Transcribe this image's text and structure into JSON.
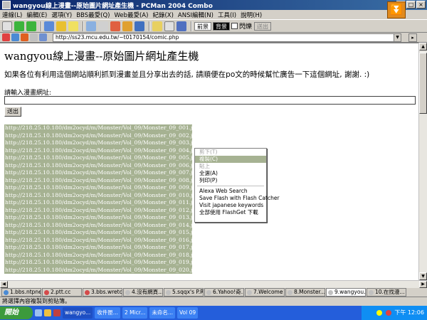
{
  "window": {
    "title": "wangyou線上漫畫--原始圖片網址產生機 - PCMan 2004 Combo"
  },
  "menu": [
    "連線(L)",
    "編輯(E)",
    "選項(Y)",
    "BBS最愛(Q)",
    "Web最愛(A)",
    "紀錄(X)",
    "ANSI編輯(N)",
    "工具(I)",
    "說明(H)"
  ],
  "toolbar": {
    "mode_front": "前景",
    "mode_back": "背景",
    "flash_label": "閃爍",
    "send_label": "送出"
  },
  "address": {
    "url": "http://ss23.mcu.edu.tw/~t0170154/comic.php"
  },
  "page": {
    "heading": "wangyou線上漫畫--原始圖片網址產生機",
    "description": "如果各位有利用這個網站順利抓到漫畫並且分享出去的話, 請順便在po文的時候幫忙廣告一下這個網址, 謝謝. :)",
    "input_label": "請輸入漫畫網址:",
    "send_button": "送出",
    "urls": [
      "http://218.25.10.180/dm2ocyd/m/Monster/Vol_09/Monster_09_001.jpg",
      "http://218.25.10.180/dm2ocyd/m/Monster/Vol_09/Monster_09_002.jpg",
      "http://218.25.10.180/dm2ocyd/m/Monster/Vol_09/Monster_09_003.jpg",
      "http://218.25.10.180/dm2ocyd/m/Monster/Vol_09/Monster_09_004.jpg",
      "http://218.25.10.180/dm2ocyd/m/Monster/Vol_09/Monster_09_005.jpg",
      "http://218.25.10.180/dm2ocyd/m/Monster/Vol_09/Monster_09_006.jpg",
      "http://218.25.10.180/dm2ocyd/m/Monster/Vol_09/Monster_09_007.jpg",
      "http://218.25.10.180/dm2ocyd/m/Monster/Vol_09/Monster_09_008.jpg",
      "http://218.25.10.180/dm2ocyd/m/Monster/Vol_09/Monster_09_009.jpg",
      "http://218.25.10.180/dm2ocyd/m/Monster/Vol_09/Monster_09_010.jpg",
      "http://218.25.10.180/dm2ocyd/m/Monster/Vol_09/Monster_09_011.jpg",
      "http://218.25.10.180/dm2ocyd/m/Monster/Vol_09/Monster_09_012.jpg",
      "http://218.25.10.180/dm2ocyd/m/Monster/Vol_09/Monster_09_013.jpg",
      "http://218.25.10.180/dm2ocyd/m/Monster/Vol_09/Monster_09_014.jpg",
      "http://218.25.10.180/dm2ocyd/m/Monster/Vol_09/Monster_09_015.jpg",
      "http://218.25.10.180/dm2ocyd/m/Monster/Vol_09/Monster_09_016.jpg",
      "http://218.25.10.180/dm2ocyd/m/Monster/Vol_09/Monster_09_017.jpg",
      "http://218.25.10.180/dm2ocyd/m/Monster/Vol_09/Monster_09_018.jpg",
      "http://218.25.10.180/dm2ocyd/m/Monster/Vol_09/Monster_09_019.jpg",
      "http://218.25.10.180/dm2ocyd/m/Monster/Vol_09/Monster_09_020.jpg"
    ]
  },
  "context_menu": {
    "items": [
      {
        "label": "剪下(T)",
        "state": "disabled"
      },
      {
        "label": "複製(C)",
        "state": "highlighted"
      },
      {
        "label": "貼上",
        "state": "disabled"
      },
      {
        "label": "全選(A)",
        "state": "normal"
      },
      {
        "label": "列印(P)",
        "state": "normal"
      }
    ],
    "extra_items": [
      "Alexa Web Search",
      "Save Flash with Flash Catcher",
      "Visit japanese keywords",
      "全部使用 FlashGet 下載"
    ]
  },
  "tabs": [
    {
      "label": "1.bbs.ntpne...",
      "color": "#4a8ad4"
    },
    {
      "label": "2.ptt.cc",
      "color": "#d44a4a"
    },
    {
      "label": "3.bbs.wretch...",
      "color": "#d44a4a"
    },
    {
      "label": "4.沒有網頁...",
      "color": "#c0c0c0"
    },
    {
      "label": "5.sqqx's P.R.I...",
      "color": "#c0c0c0"
    },
    {
      "label": "6.Yahoo!奇...",
      "color": "#c0c0c0"
    },
    {
      "label": "7.Welcome t...",
      "color": "#c0c0c0"
    },
    {
      "label": "8.Monster...",
      "color": "#c0c0c0"
    },
    {
      "label": "9.wangyou...",
      "color": "#c0c0c0",
      "active": true
    },
    {
      "label": "10.在找漫...",
      "color": "#c0c0c0"
    }
  ],
  "status": {
    "text": "將選擇內容複製到剪貼簿。"
  },
  "taskbar": {
    "start": "開始",
    "tasks": [
      "wangyo...",
      "收件匣...",
      "2 Micr...",
      "未命名...",
      "Vol 09"
    ],
    "time": "下午 12:06"
  },
  "colors": {
    "selection": "#a6b292",
    "titlebar": "#0a246a",
    "taskbar": "#245edb"
  }
}
